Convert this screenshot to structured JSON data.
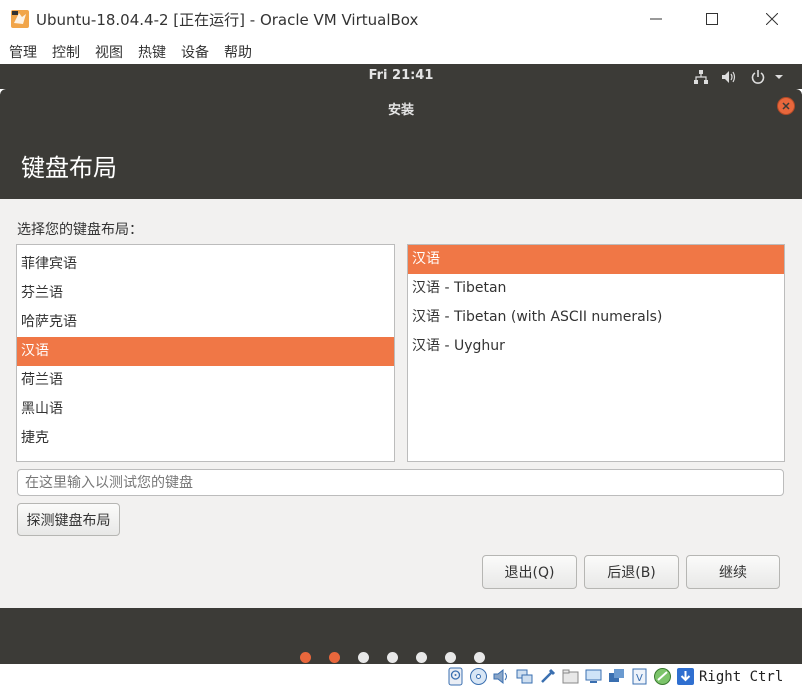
{
  "window": {
    "title": "Ubuntu-18.04.4-2 [正在运行] - Oracle VM VirtualBox"
  },
  "menu": [
    "管理",
    "控制",
    "视图",
    "热键",
    "设备",
    "帮助"
  ],
  "panel": {
    "clock": "Fri 21:41",
    "icons": [
      "network-icon",
      "volume-icon",
      "power-icon",
      "chevron-down-icon"
    ]
  },
  "installer": {
    "title": "安装",
    "heading": "键盘布局",
    "prompt": "选择您的键盘布局：",
    "languages": {
      "selected_index": 3,
      "items": [
        "菲律宾语",
        "芬兰语",
        "哈萨克语",
        "汉语",
        "荷兰语",
        "黑山语",
        "捷克"
      ]
    },
    "variants": {
      "selected_index": 0,
      "items": [
        "汉语",
        "汉语 - Tibetan",
        "汉语 - Tibetan (with ASCII numerals)",
        "汉语 - Uyghur"
      ]
    },
    "test_placeholder": "在这里输入以测试您的键盘",
    "detect_label": "探测键盘布局",
    "buttons": {
      "quit": "退出(Q)",
      "back": "后退(B)",
      "continue": "继续"
    },
    "progress": {
      "total_steps": 7,
      "completed_steps": 2
    }
  },
  "statusbar": {
    "host_key": "Right Ctrl"
  },
  "colors": {
    "accent": "#f07746",
    "dark": "#3c3b37",
    "window_bg": "#f2f1f0"
  }
}
